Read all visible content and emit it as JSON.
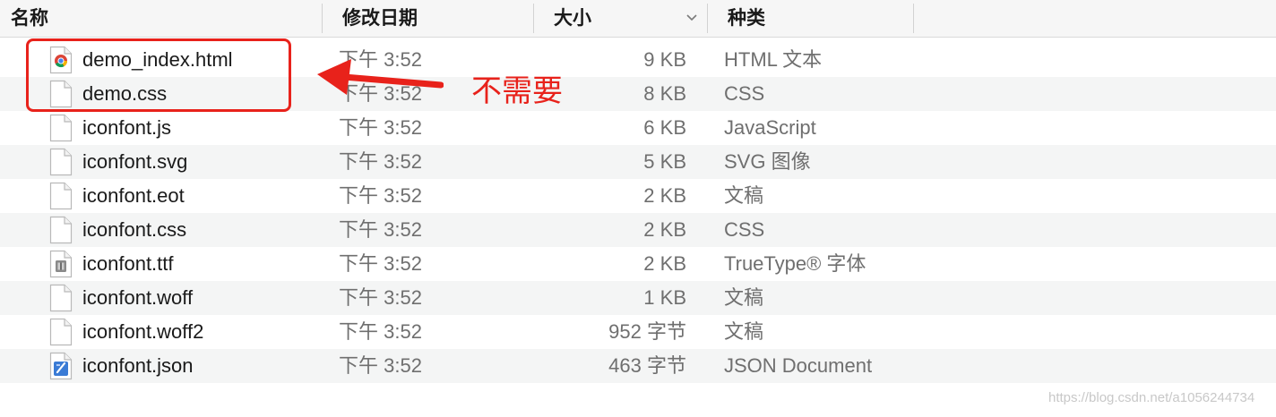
{
  "columns": {
    "name": "名称",
    "date": "修改日期",
    "size": "大小",
    "kind": "种类"
  },
  "files": [
    {
      "name": "demo_index.html",
      "date": "下午 3:52",
      "size": "9 KB",
      "kind": "HTML 文本",
      "icon": "chrome-html-file-icon"
    },
    {
      "name": "demo.css",
      "date": "下午 3:52",
      "size": "8 KB",
      "kind": "CSS",
      "icon": "blank-file-icon"
    },
    {
      "name": "iconfont.js",
      "date": "下午 3:52",
      "size": "6 KB",
      "kind": "JavaScript",
      "icon": "blank-file-icon"
    },
    {
      "name": "iconfont.svg",
      "date": "下午 3:52",
      "size": "5 KB",
      "kind": "SVG 图像",
      "icon": "blank-file-icon"
    },
    {
      "name": "iconfont.eot",
      "date": "下午 3:52",
      "size": "2 KB",
      "kind": "文稿",
      "icon": "blank-file-icon"
    },
    {
      "name": "iconfont.css",
      "date": "下午 3:52",
      "size": "2 KB",
      "kind": "CSS",
      "icon": "blank-file-icon"
    },
    {
      "name": "iconfont.ttf",
      "date": "下午 3:52",
      "size": "2 KB",
      "kind": "TrueType® 字体",
      "icon": "font-file-icon"
    },
    {
      "name": "iconfont.woff",
      "date": "下午 3:52",
      "size": "1 KB",
      "kind": "文稿",
      "icon": "blank-file-icon"
    },
    {
      "name": "iconfont.woff2",
      "date": "下午 3:52",
      "size": "952 字节",
      "kind": "文稿",
      "icon": "blank-file-icon"
    },
    {
      "name": "iconfont.json",
      "date": "下午 3:52",
      "size": "463 字节",
      "kind": "JSON Document",
      "icon": "json-file-icon"
    }
  ],
  "annotation": {
    "text": "不需要",
    "color": "#e8221b"
  },
  "watermark": "https://blog.csdn.net/a1056244734"
}
